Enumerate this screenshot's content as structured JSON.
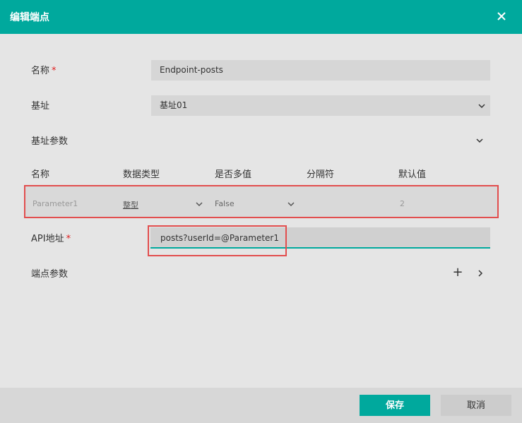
{
  "dialog": {
    "title": "编辑端点"
  },
  "form": {
    "name_label": "名称",
    "required_mark": "*",
    "name_value": "Endpoint-posts",
    "base_label": "基址",
    "base_value": "基址01",
    "base_params_label": "基址参数",
    "api_label": "API地址",
    "api_value": "posts?userId=@Parameter1",
    "endpoint_params_label": "端点参数",
    "add_symbol": "+"
  },
  "params_table": {
    "columns": [
      "名称",
      "数据类型",
      "是否多值",
      "分隔符",
      "默认值"
    ],
    "rows": [
      {
        "name": "Parameter1",
        "type": "整型",
        "multi": "False",
        "separator": "",
        "default": "2"
      }
    ]
  },
  "footer": {
    "save_label": "保存",
    "cancel_label": "取消"
  },
  "colors": {
    "accent": "#00a99d",
    "highlight": "#e24e4e",
    "required": "#e02020"
  }
}
